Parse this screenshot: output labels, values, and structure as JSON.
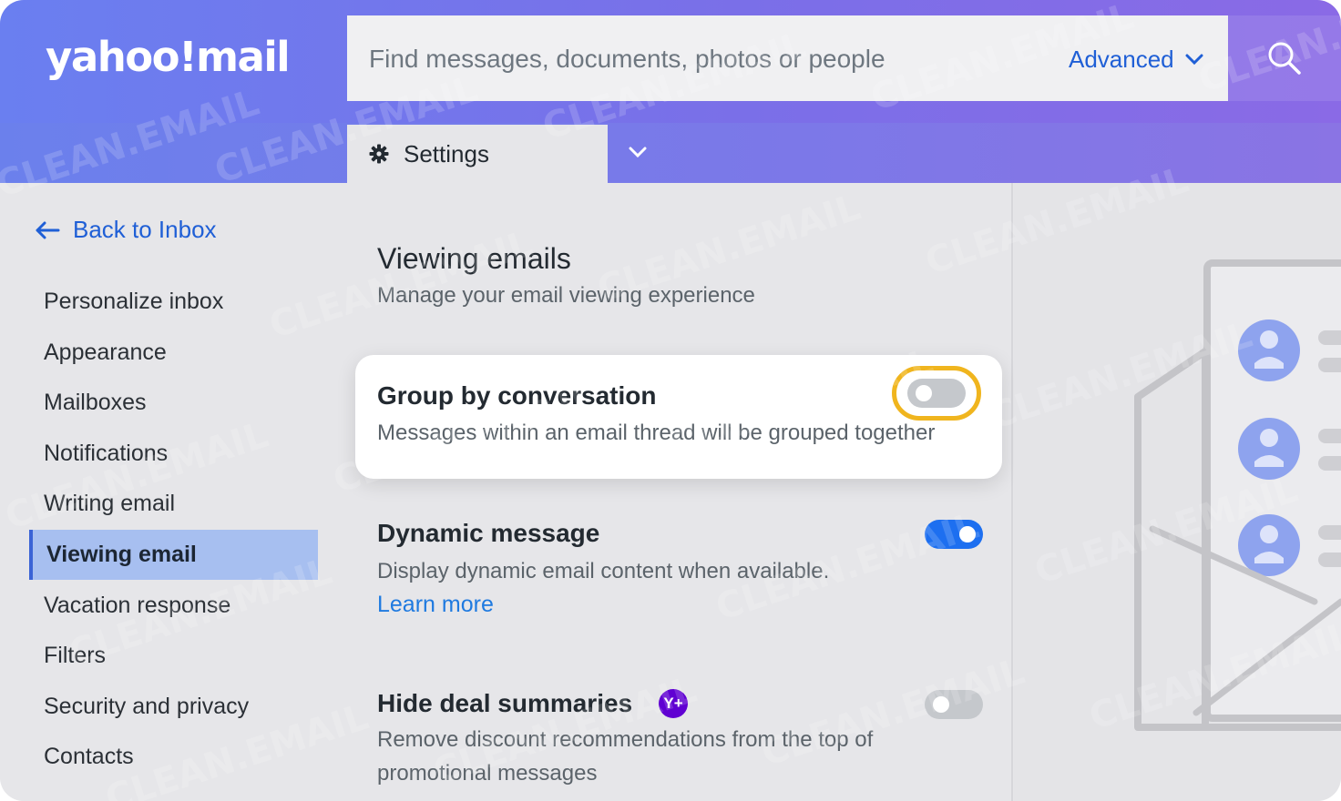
{
  "brand": {
    "logo_text": "yahoo!mail"
  },
  "search": {
    "placeholder": "Find messages, documents, photos or people",
    "advanced_label": "Advanced",
    "search_icon": "search-icon"
  },
  "tab": {
    "label": "Settings",
    "icon": "gear-icon"
  },
  "sidebar": {
    "back_label": "Back to Inbox",
    "items": [
      {
        "label": "Personalize inbox",
        "active": false
      },
      {
        "label": "Appearance",
        "active": false
      },
      {
        "label": "Mailboxes",
        "active": false
      },
      {
        "label": "Notifications",
        "active": false
      },
      {
        "label": "Writing email",
        "active": false
      },
      {
        "label": "Viewing email",
        "active": true
      },
      {
        "label": "Vacation response",
        "active": false
      },
      {
        "label": "Filters",
        "active": false
      },
      {
        "label": "Security and privacy",
        "active": false
      },
      {
        "label": "Contacts",
        "active": false
      }
    ]
  },
  "main": {
    "title": "Viewing emails",
    "subtitle": "Manage your email viewing experience",
    "options": [
      {
        "title": "Group by conversation",
        "description": "Messages within an email thread will be grouped together",
        "enabled": false,
        "highlighted": true
      },
      {
        "title": "Dynamic message",
        "description": "Display dynamic email content when available.",
        "link": "Learn more",
        "enabled": true
      },
      {
        "title": "Hide deal summaries",
        "badge": "Y+",
        "description_line1": "Remove discount recommendations from the top of",
        "description_line2": "promotional messages",
        "enabled": false
      }
    ]
  },
  "watermark": "CLEAN.EMAIL",
  "colors": {
    "header": "#7a74ea",
    "link": "#1f5fd6",
    "active_nav": "#a7bff0",
    "toggle_on": "#1d6ff0",
    "toggle_off": "#c5c8cc",
    "highlight_ring": "#f0b51e",
    "plus_badge": "#6001d2"
  }
}
